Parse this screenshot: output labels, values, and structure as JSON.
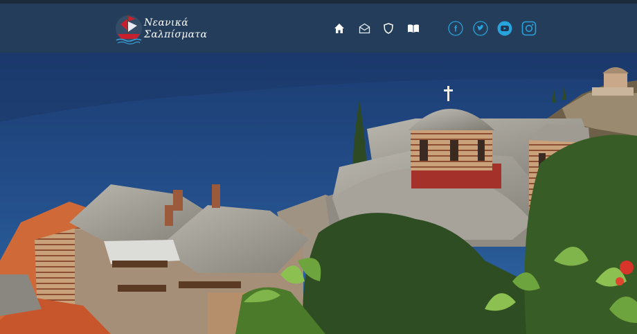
{
  "site": {
    "brand_line1": "Νεανικά",
    "brand_line2": "Σαλπίσματα"
  },
  "nav": [
    {
      "icon": "home-icon"
    },
    {
      "icon": "envelope-icon"
    },
    {
      "icon": "shield-icon"
    },
    {
      "icon": "book-icon"
    }
  ],
  "social": [
    {
      "icon": "facebook-icon",
      "glyph": "f"
    },
    {
      "icon": "twitter-icon"
    },
    {
      "icon": "youtube-icon"
    },
    {
      "icon": "instagram-icon"
    }
  ],
  "colors": {
    "header_bg": "#243d5a",
    "social_accent": "#29a3dc",
    "sea": "#1e3f73"
  }
}
